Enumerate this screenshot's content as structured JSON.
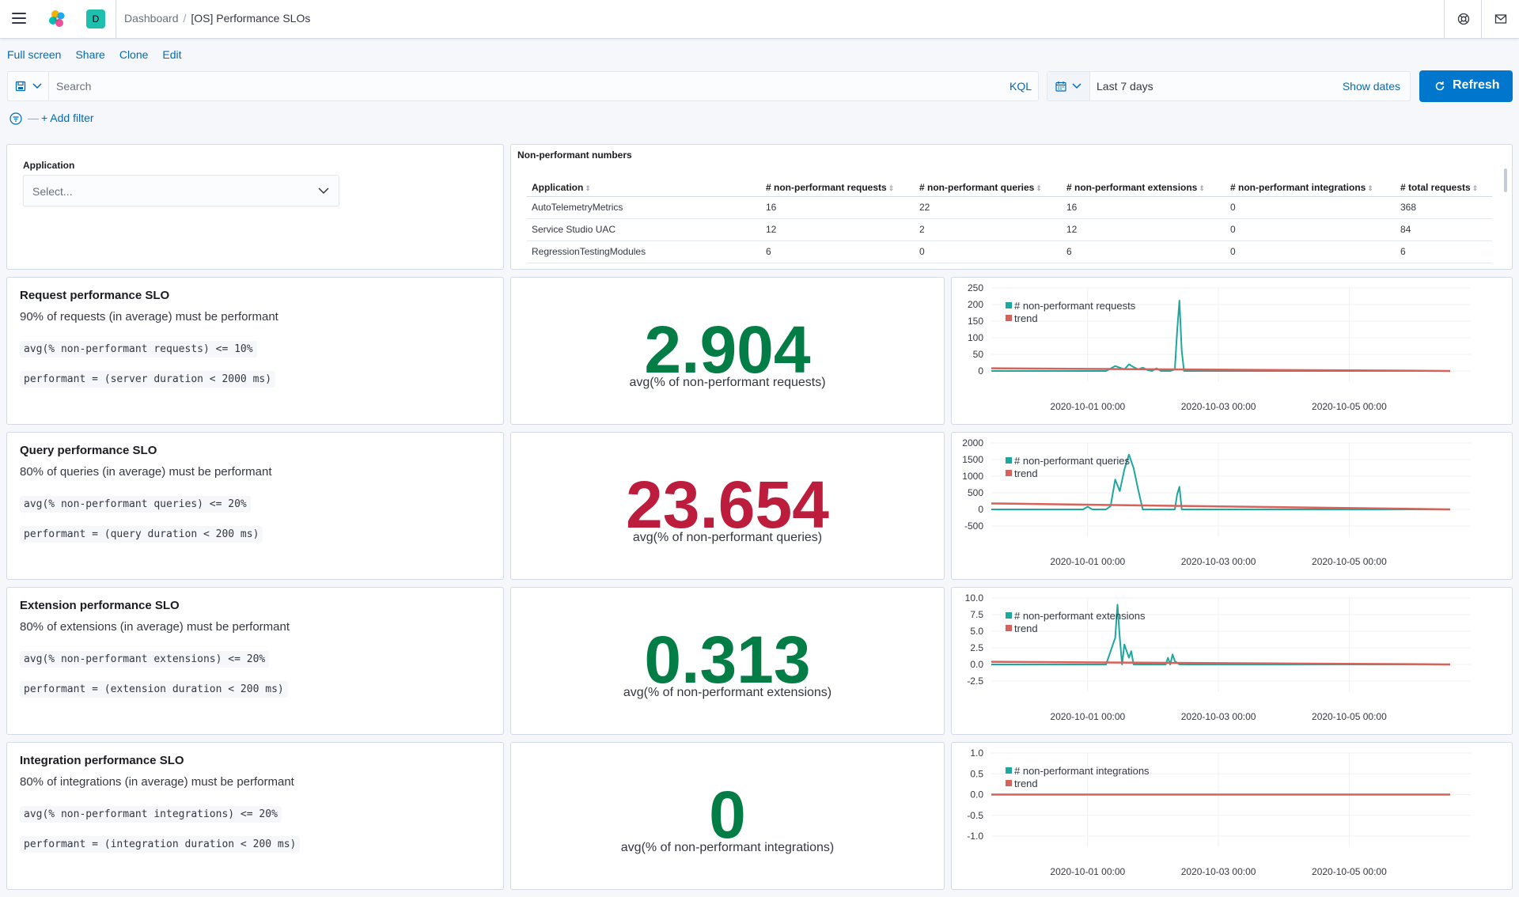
{
  "header": {
    "space_initial": "D",
    "breadcrumb_root": "Dashboard",
    "breadcrumb_current": "[OS] Performance SLOs"
  },
  "menu": {
    "full_screen": "Full screen",
    "share": "Share",
    "clone": "Clone",
    "edit": "Edit"
  },
  "query": {
    "placeholder": "Search",
    "language": "KQL"
  },
  "time": {
    "range": "Last 7 days",
    "show_dates": "Show dates",
    "refresh": "Refresh"
  },
  "filter": {
    "add_filter": "+ Add filter"
  },
  "application_control": {
    "label": "Application",
    "placeholder": "Select..."
  },
  "table": {
    "title": "Non-performant numbers",
    "columns": [
      "Application",
      "# non-performant requests",
      "# non-performant queries",
      "# non-performant extensions",
      "# non-performant integrations",
      "# total requests"
    ],
    "rows": [
      [
        "AutoTelemetryMetrics",
        "16",
        "22",
        "16",
        "0",
        "368"
      ],
      [
        "Service Studio UAC",
        "12",
        "2",
        "12",
        "0",
        "84"
      ],
      [
        "RegressionTestingModules",
        "6",
        "0",
        "6",
        "0",
        "6"
      ]
    ]
  },
  "slos": [
    {
      "title": "Request performance SLO",
      "description": "90% of requests (in average) must be performant",
      "rule": "avg(% non-performant requests) <= 10%",
      "definition": "performant = (server duration < 2000 ms)",
      "metric_value": "2.904",
      "metric_label": "avg(% of non-performant requests)",
      "metric_color": "#017d45"
    },
    {
      "title": "Query performance SLO",
      "description": "80% of queries (in average) must be performant",
      "rule": "avg(% non-performant queries) <= 20%",
      "definition": "performant = (query duration < 200 ms)",
      "metric_value": "23.654",
      "metric_label": "avg(% of non-performant queries)",
      "metric_color": "#bd1d3c"
    },
    {
      "title": "Extension performance SLO",
      "description": "80% of extensions (in average) must be performant",
      "rule": "avg(% non-performant extensions) <= 20%",
      "definition": "performant = (extension duration < 200 ms)",
      "metric_value": "0.313",
      "metric_label": "avg(% of non-performant extensions)",
      "metric_color": "#017d45"
    },
    {
      "title": "Integration performance SLO",
      "description": "80% of integrations (in average) must be performant",
      "rule": "avg(% non-performant integrations) <= 20%",
      "definition": "performant = (integration duration < 200 ms)",
      "metric_value": "0",
      "metric_label": "avg(% of non-performant integrations)",
      "metric_color": "#017d45"
    }
  ],
  "colors": {
    "series": "#1ea79f",
    "trend": "#d6625a",
    "link": "#006bb8",
    "primary": "#0077cc"
  },
  "chart_data": [
    {
      "type": "line",
      "yticks": [
        "250",
        "200",
        "150",
        "100",
        "50",
        "0"
      ],
      "ylim": [
        0,
        250
      ],
      "xticks": [
        "2020-10-01 00:00",
        "2020-10-03 00:00",
        "2020-10-05 00:00"
      ],
      "legend_position": "top-left",
      "series": [
        {
          "name": "# non-performant requests",
          "x": [
            0,
            0.2,
            0.25,
            0.27,
            0.29,
            0.3,
            0.31,
            0.32,
            0.33,
            0.34,
            0.35,
            0.36,
            0.37,
            0.38,
            0.39,
            0.4,
            0.405,
            0.41,
            0.415,
            0.42,
            0.44,
            1
          ],
          "values": [
            0,
            0,
            0,
            15,
            5,
            20,
            12,
            5,
            10,
            3,
            0,
            8,
            0,
            0,
            0,
            5,
            120,
            212,
            60,
            0,
            0,
            0
          ]
        },
        {
          "name": "trend",
          "x": [
            0,
            1
          ],
          "values": [
            8,
            0
          ]
        }
      ]
    },
    {
      "type": "line",
      "yticks": [
        "2000",
        "1500",
        "1000",
        "500",
        "0",
        "-500"
      ],
      "ylim": [
        -500,
        2000
      ],
      "xticks": [
        "2020-10-01 00:00",
        "2020-10-03 00:00",
        "2020-10-05 00:00"
      ],
      "legend_position": "top-left",
      "series": [
        {
          "name": "# non-performant queries",
          "x": [
            0,
            0.2,
            0.21,
            0.22,
            0.25,
            0.26,
            0.27,
            0.28,
            0.29,
            0.3,
            0.31,
            0.32,
            0.33,
            0.34,
            0.35,
            0.37,
            0.4,
            0.405,
            0.41,
            0.415,
            0.42,
            1
          ],
          "values": [
            0,
            0,
            80,
            0,
            0,
            100,
            900,
            550,
            1200,
            1650,
            1250,
            600,
            0,
            0,
            0,
            0,
            0,
            450,
            680,
            0,
            0,
            0
          ]
        },
        {
          "name": "trend",
          "x": [
            0,
            1
          ],
          "values": [
            180,
            0
          ]
        }
      ]
    },
    {
      "type": "line",
      "yticks": [
        "10.0",
        "7.5",
        "5.0",
        "2.5",
        "0.0",
        "-2.5"
      ],
      "ylim": [
        -2.5,
        10
      ],
      "xticks": [
        "2020-10-01 00:00",
        "2020-10-03 00:00",
        "2020-10-05 00:00"
      ],
      "legend_position": "top-left",
      "series": [
        {
          "name": "# non-performant extensions",
          "x": [
            0,
            0.25,
            0.26,
            0.27,
            0.275,
            0.28,
            0.285,
            0.29,
            0.3,
            0.305,
            0.31,
            0.32,
            0.33,
            0.38,
            0.385,
            0.39,
            0.395,
            0.4,
            0.41,
            1
          ],
          "values": [
            0,
            0,
            2,
            4,
            9,
            4,
            0,
            3,
            1,
            2,
            0,
            0,
            0,
            0,
            1,
            0,
            1.5,
            0.5,
            0,
            0
          ]
        },
        {
          "name": "trend",
          "x": [
            0,
            1
          ],
          "values": [
            0.4,
            0
          ]
        }
      ]
    },
    {
      "type": "line",
      "yticks": [
        "1.0",
        "0.5",
        "0.0",
        "-0.5",
        "-1.0"
      ],
      "ylim": [
        -1,
        1
      ],
      "xticks": [
        "2020-10-01 00:00",
        "2020-10-03 00:00",
        "2020-10-05 00:00"
      ],
      "legend_position": "top-left",
      "series": [
        {
          "name": "# non-performant integrations",
          "x": [
            0,
            1
          ],
          "values": [
            0,
            0
          ]
        },
        {
          "name": "trend",
          "x": [
            0,
            1
          ],
          "values": [
            0,
            0
          ]
        }
      ]
    }
  ]
}
